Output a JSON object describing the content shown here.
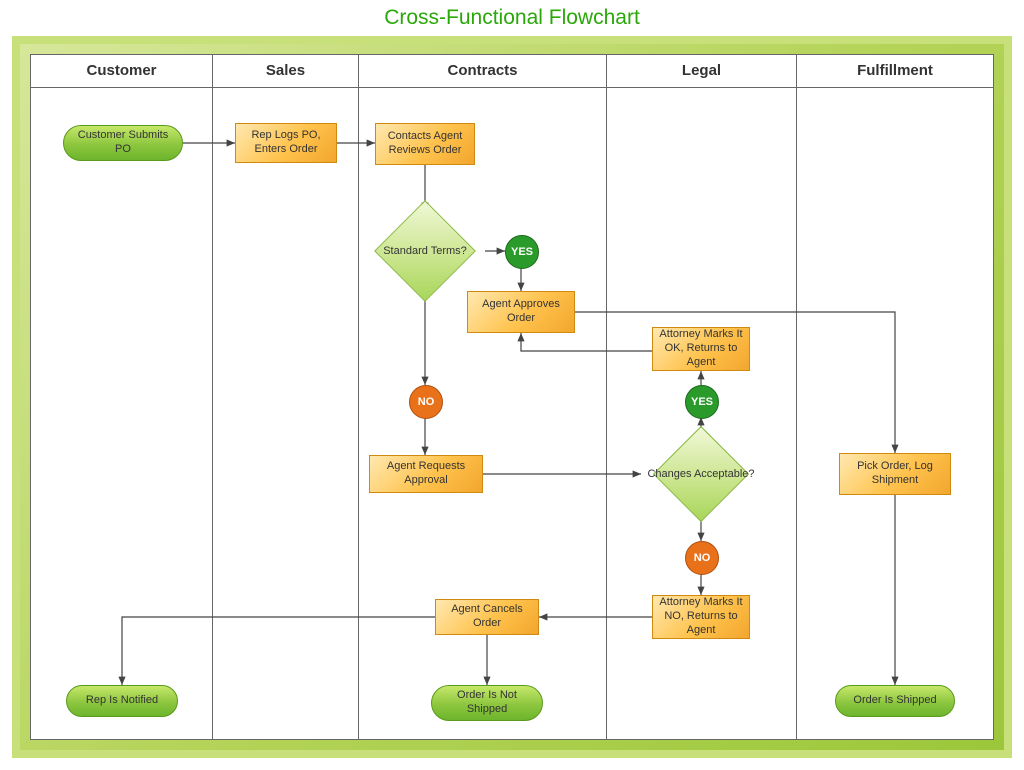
{
  "title": "Cross-Functional Flowchart",
  "lanes": {
    "customer": "Customer",
    "sales": "Sales",
    "contracts": "Contracts",
    "legal": "Legal",
    "fulfillment": "Fulfillment"
  },
  "nodes": {
    "customer_submits_po": "Customer Submits PO",
    "rep_logs_po": "Rep Logs PO, Enters Order",
    "contacts_agent_reviews": "Contacts Agent Reviews Order",
    "standard_terms": "Standard Terms?",
    "agent_approves": "Agent Approves Order",
    "attorney_ok": "Attorney Marks It OK, Returns to Agent",
    "agent_requests_approval": "Agent Requests Approval",
    "changes_acceptable": "Changes Acceptable?",
    "pick_order": "Pick Order, Log Shipment",
    "attorney_no": "Attorney Marks It NO, Returns to Agent",
    "agent_cancels": "Agent Cancels Order",
    "rep_notified": "Rep Is Notified",
    "order_not_shipped": "Order Is Not Shipped",
    "order_shipped": "Order Is Shipped"
  },
  "labels": {
    "yes": "YES",
    "no": "NO"
  }
}
